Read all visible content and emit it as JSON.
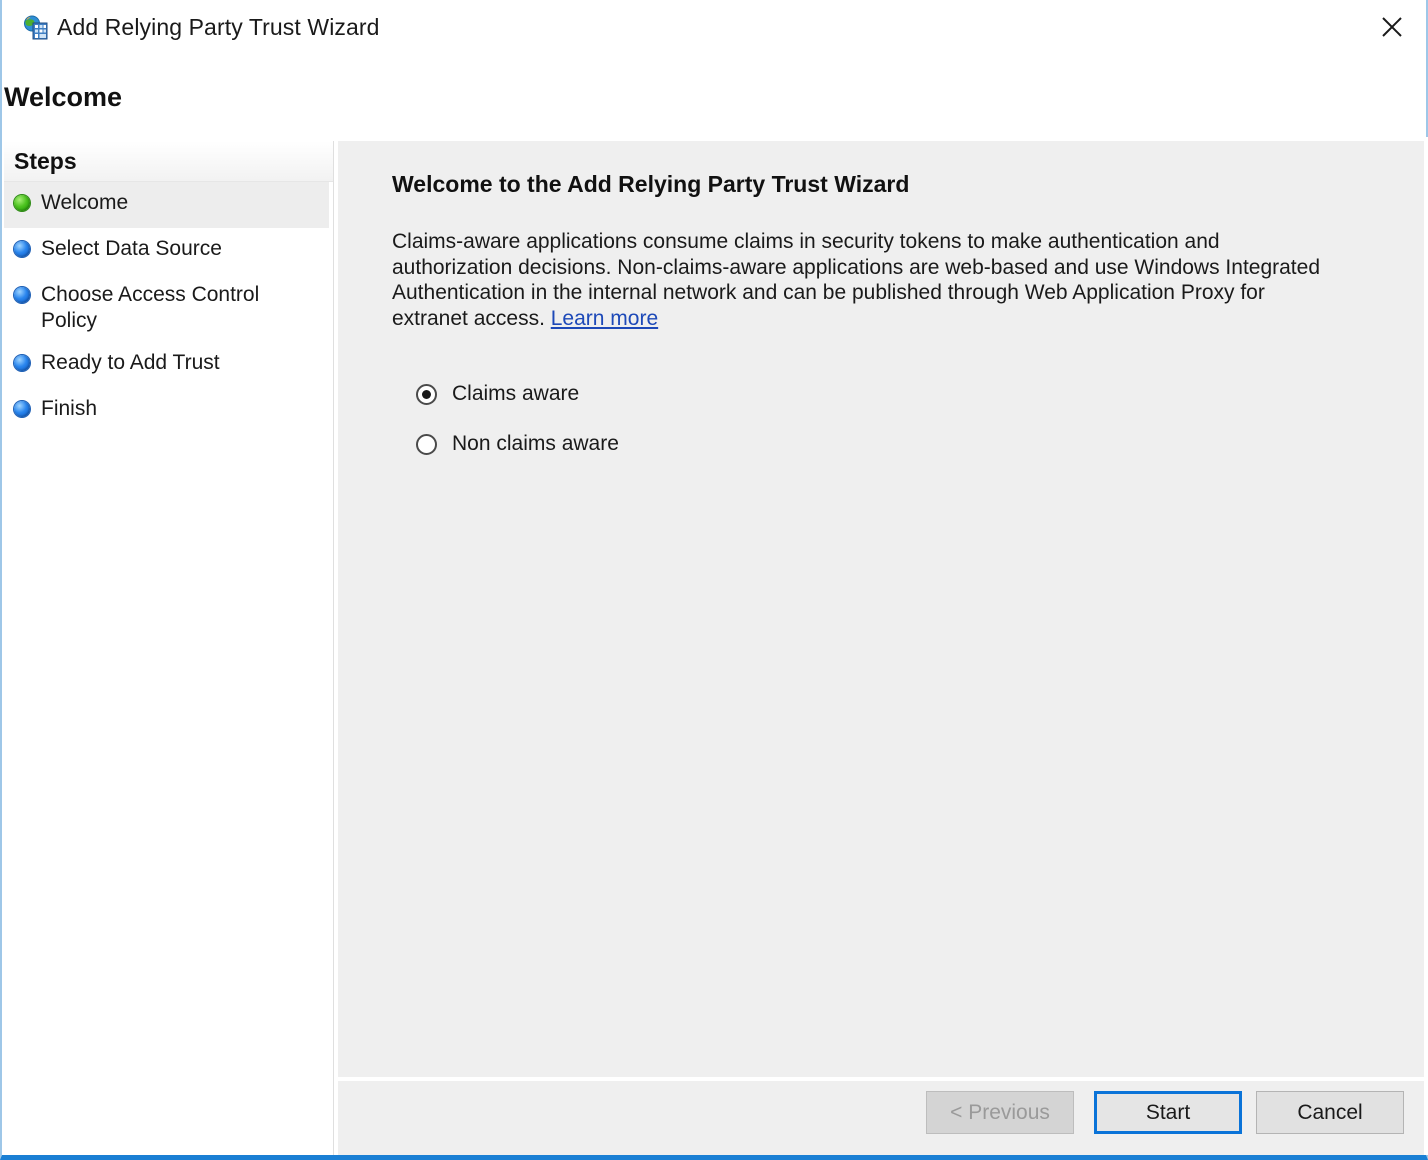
{
  "window": {
    "title": "Add Relying Party Trust Wizard",
    "icon": "relying-party-trust-icon",
    "close_icon": "close-icon",
    "page_heading": "Welcome",
    "accent_color": "#1a7fd4",
    "border_color": "#9ec7e8"
  },
  "sidebar": {
    "header": "Steps",
    "items": [
      {
        "label": "Welcome",
        "bullet": "green",
        "selected": true
      },
      {
        "label": "Select Data Source",
        "bullet": "blue",
        "selected": false
      },
      {
        "label": "Choose Access Control Policy",
        "bullet": "blue",
        "selected": false
      },
      {
        "label": "Ready to Add Trust",
        "bullet": "blue",
        "selected": false
      },
      {
        "label": "Finish",
        "bullet": "blue",
        "selected": false
      }
    ]
  },
  "main": {
    "title": "Welcome to the Add Relying Party Trust Wizard",
    "paragraph_before_link": "Claims-aware applications consume claims in security tokens to make authentication and authorization decisions. Non-claims-aware applications are web-based and use Windows Integrated Authentication in the internal network and can be published through Web Application Proxy for extranet access. ",
    "link_label": "Learn more",
    "link_color": "#1d49b8",
    "radio_options": [
      {
        "label": "Claims aware",
        "checked": true
      },
      {
        "label": "Non claims aware",
        "checked": false
      }
    ]
  },
  "footer": {
    "previous_label": "< Previous",
    "previous_disabled": true,
    "start_label": "Start",
    "start_default": true,
    "cancel_label": "Cancel"
  }
}
